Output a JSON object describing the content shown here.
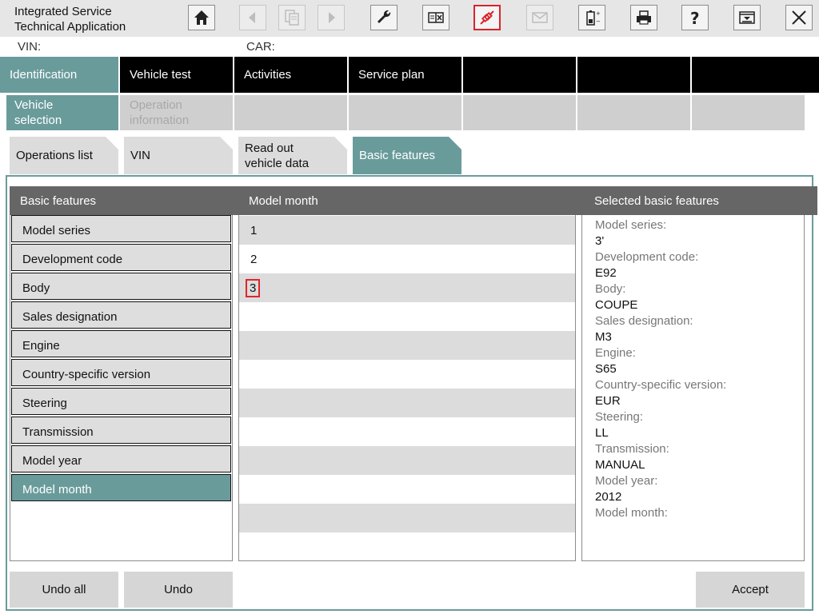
{
  "app": {
    "title_line1": "Integrated Service",
    "title_line2": "Technical Application"
  },
  "toolbar_icons": [
    "home-icon",
    "back-icon",
    "documents-icon",
    "forward-icon",
    "wrench-icon",
    "split-view-icon",
    "connection-plug-icon",
    "mail-icon",
    "battery-icon",
    "printer-icon",
    "help-icon",
    "dropdown-window-icon",
    "close-icon"
  ],
  "vehicle_info": {
    "vin_label": "VIN:",
    "car_label": "CAR:"
  },
  "main_tabs": [
    "Identification",
    "Vehicle test",
    "Activities",
    "Service plan",
    "",
    "",
    ""
  ],
  "sub_tabs": [
    {
      "line1": "Vehicle",
      "line2": "selection"
    },
    {
      "line1": "Operation",
      "line2": "information"
    }
  ],
  "folder_tabs": [
    {
      "line1": "Operations list",
      "line2": ""
    },
    {
      "line1": "VIN",
      "line2": ""
    },
    {
      "line1": "Read out",
      "line2": "vehicle data"
    },
    {
      "line1": "Basic features",
      "line2": ""
    }
  ],
  "basic_features": {
    "header": "Basic features",
    "items": [
      "Model series",
      "Development code",
      "Body",
      "Sales designation",
      "Engine",
      "Country-specific version",
      "Steering",
      "Transmission",
      "Model year",
      "Model month"
    ],
    "selected": "Model month"
  },
  "model_month": {
    "header": "Model month",
    "options": [
      "1",
      "2",
      "3"
    ],
    "highlighted": "3"
  },
  "selected_features": {
    "header": "Selected basic features",
    "entries": [
      {
        "label": "Model series:",
        "value": "3'"
      },
      {
        "label": "Development code:",
        "value": "E92"
      },
      {
        "label": "Body:",
        "value": "COUPE"
      },
      {
        "label": "Sales designation:",
        "value": "M3"
      },
      {
        "label": "Engine:",
        "value": "S65"
      },
      {
        "label": "Country-specific version:",
        "value": "EUR"
      },
      {
        "label": "Steering:",
        "value": "LL"
      },
      {
        "label": "Transmission:",
        "value": "MANUAL"
      },
      {
        "label": "Model year:",
        "value": "2012"
      },
      {
        "label": "Model month:",
        "value": ""
      }
    ]
  },
  "buttons": {
    "undo_all": "Undo all",
    "undo": "Undo",
    "accept": "Accept"
  },
  "colors": {
    "accent": "#6a9b9b",
    "header_gray": "#666666",
    "highlight_red": "#e2242a"
  }
}
